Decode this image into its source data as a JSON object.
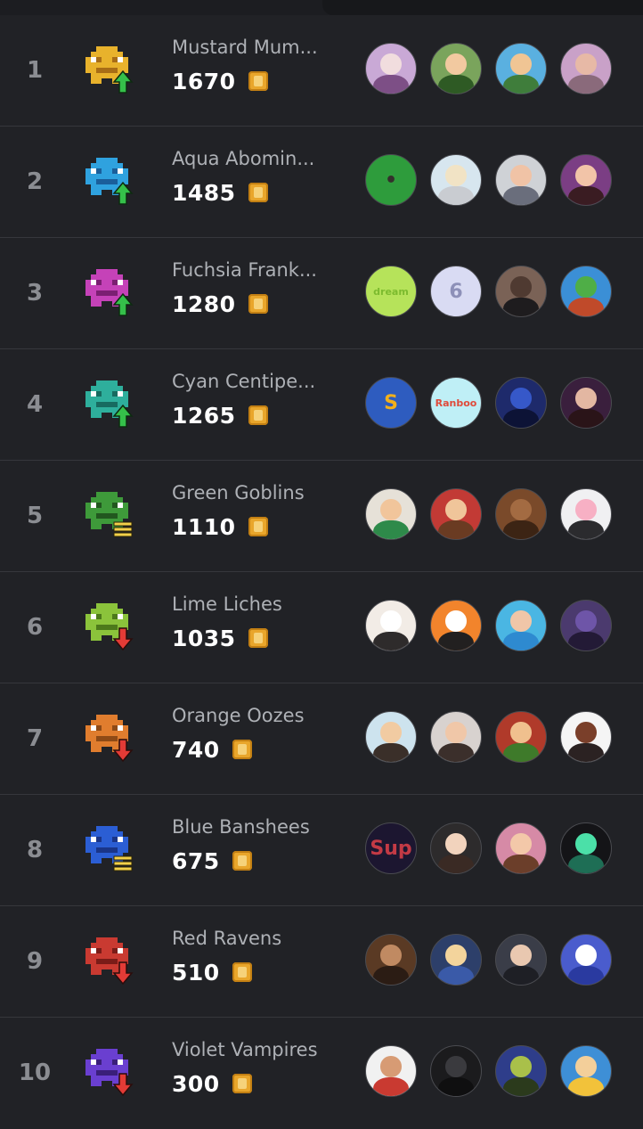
{
  "leaderboard": [
    {
      "rank": "1",
      "team": "Mustard Mum...",
      "points": "1670",
      "trend": "up",
      "color": "#e8b22c",
      "colorDark": "#a86d16",
      "players": [
        [
          "#c9a9d6",
          "#f1ddde",
          "#7d4f86"
        ],
        [
          "#7aa45c",
          "#f2c9a0",
          "#2e5a24"
        ],
        [
          "#5ab0e0",
          "#f0c594",
          "#3f7d3b"
        ],
        [
          "#c9a1c8",
          "#e7b9a6",
          "#8a6a7b"
        ]
      ]
    },
    {
      "rank": "2",
      "team": "Aqua Abomin...",
      "points": "1485",
      "trend": "up",
      "color": "#2fa2df",
      "colorDark": "#1a5f9b",
      "players": [
        [
          "#2e9c3c",
          "#c8b7a0",
          "#34302c",
          "•"
        ],
        [
          "#d7e6ef",
          "#f1e3c5",
          "#c9ccd1"
        ],
        [
          "#cfd2d6",
          "#f0c3a6",
          "#6a6e7c"
        ],
        [
          "#7b3e84",
          "#f2c4a8",
          "#3a1c22"
        ]
      ]
    },
    {
      "rank": "3",
      "team": "Fuchsia Frank...",
      "points": "1280",
      "trend": "up",
      "color": "#c542b8",
      "colorDark": "#7b1f72",
      "players": [
        [
          "#b6e35a",
          "#ffffff",
          "#7cbb2e",
          "dream"
        ],
        [
          "#d9dbf3",
          "#ffffff",
          "#8d90b8",
          "6"
        ],
        [
          "#7a6256",
          "#4f3a31",
          "#1e1c1e"
        ],
        [
          "#3b8fd6",
          "#4fae47",
          "#c04a2a"
        ]
      ]
    },
    {
      "rank": "4",
      "team": "Cyan Centipe...",
      "points": "1265",
      "trend": "up",
      "color": "#2eaf9c",
      "colorDark": "#176b60",
      "players": [
        [
          "#2e5cbf",
          "#e33b2b",
          "#f2b01c",
          "S"
        ],
        [
          "#bfeff6",
          "#ffffff",
          "#e04a3a",
          "Ranboo"
        ],
        [
          "#1e2a6b",
          "#3658c9",
          "#0d1336"
        ],
        [
          "#3a1f3d",
          "#e3b7a2",
          "#2a1418"
        ]
      ]
    },
    {
      "rank": "5",
      "team": "Green Goblins",
      "points": "1110",
      "trend": "same",
      "color": "#3e9a3a",
      "colorDark": "#22571f",
      "players": [
        [
          "#e6e1d8",
          "#f1c59b",
          "#2e8a4a"
        ],
        [
          "#c23a35",
          "#f0c59a",
          "#6a3b22"
        ],
        [
          "#7a4a2a",
          "#a36b42",
          "#3c2414"
        ],
        [
          "#f0f0f2",
          "#f7b0c4",
          "#2b2b2e"
        ]
      ]
    },
    {
      "rank": "6",
      "team": "Lime Liches",
      "points": "1035",
      "trend": "down",
      "color": "#8bc33b",
      "colorDark": "#4d7a1b",
      "players": [
        [
          "#f2ece6",
          "#ffffff",
          "#2e2b2b"
        ],
        [
          "#f2842c",
          "#ffffff",
          "#222020"
        ],
        [
          "#4ab6e3",
          "#f0c6a8",
          "#2e8ad0"
        ],
        [
          "#4b3a6e",
          "#6e55a8",
          "#231a36"
        ]
      ]
    },
    {
      "rank": "7",
      "team": "Orange Oozes",
      "points": "740",
      "trend": "down",
      "color": "#e07d2e",
      "colorDark": "#8e4a16",
      "players": [
        [
          "#cde3ee",
          "#f1cba2",
          "#3a2f29"
        ],
        [
          "#d8d2cf",
          "#f0c7a8",
          "#3b2f2b"
        ],
        [
          "#b03a2a",
          "#f0c08e",
          "#3e7a2a"
        ],
        [
          "#f5f5f5",
          "#7a3f2a",
          "#2b2222"
        ]
      ]
    },
    {
      "rank": "8",
      "team": "Blue Banshees",
      "points": "675",
      "trend": "same",
      "color": "#2b5ed4",
      "colorDark": "#1a3588",
      "players": [
        [
          "#1c1630",
          "#6a4aa8",
          "#c33a45",
          "Sup"
        ],
        [
          "#2d2b2c",
          "#f2d3bd",
          "#3a2a24"
        ],
        [
          "#d68aa6",
          "#f3c8a9",
          "#6b3e2a"
        ],
        [
          "#141417",
          "#4be0a8",
          "#1e6e55"
        ]
      ]
    },
    {
      "rank": "9",
      "team": "Red Ravens",
      "points": "510",
      "trend": "down",
      "color": "#c93a31",
      "colorDark": "#7a1c18",
      "players": [
        [
          "#5a3a24",
          "#c08a62",
          "#2b1c14"
        ],
        [
          "#2d3f6a",
          "#f3d49c",
          "#3a5aa8"
        ],
        [
          "#3a3d48",
          "#e9c8b0",
          "#1e1f25"
        ],
        [
          "#4a5ccd",
          "#ffffff",
          "#2a3aa0"
        ]
      ]
    },
    {
      "rank": "10",
      "team": "Violet Vampires",
      "points": "300",
      "trend": "down",
      "color": "#6a3fd0",
      "colorDark": "#3a1f7a",
      "players": [
        [
          "#f1f1f1",
          "#d79b74",
          "#c93a31"
        ],
        [
          "#1b1b1d",
          "#3a3a3e",
          "#0f0f10"
        ],
        [
          "#2e3d8a",
          "#a9c04a",
          "#2b3a1c"
        ],
        [
          "#3e8fd6",
          "#f3cf9a",
          "#f2c23a"
        ]
      ]
    }
  ]
}
